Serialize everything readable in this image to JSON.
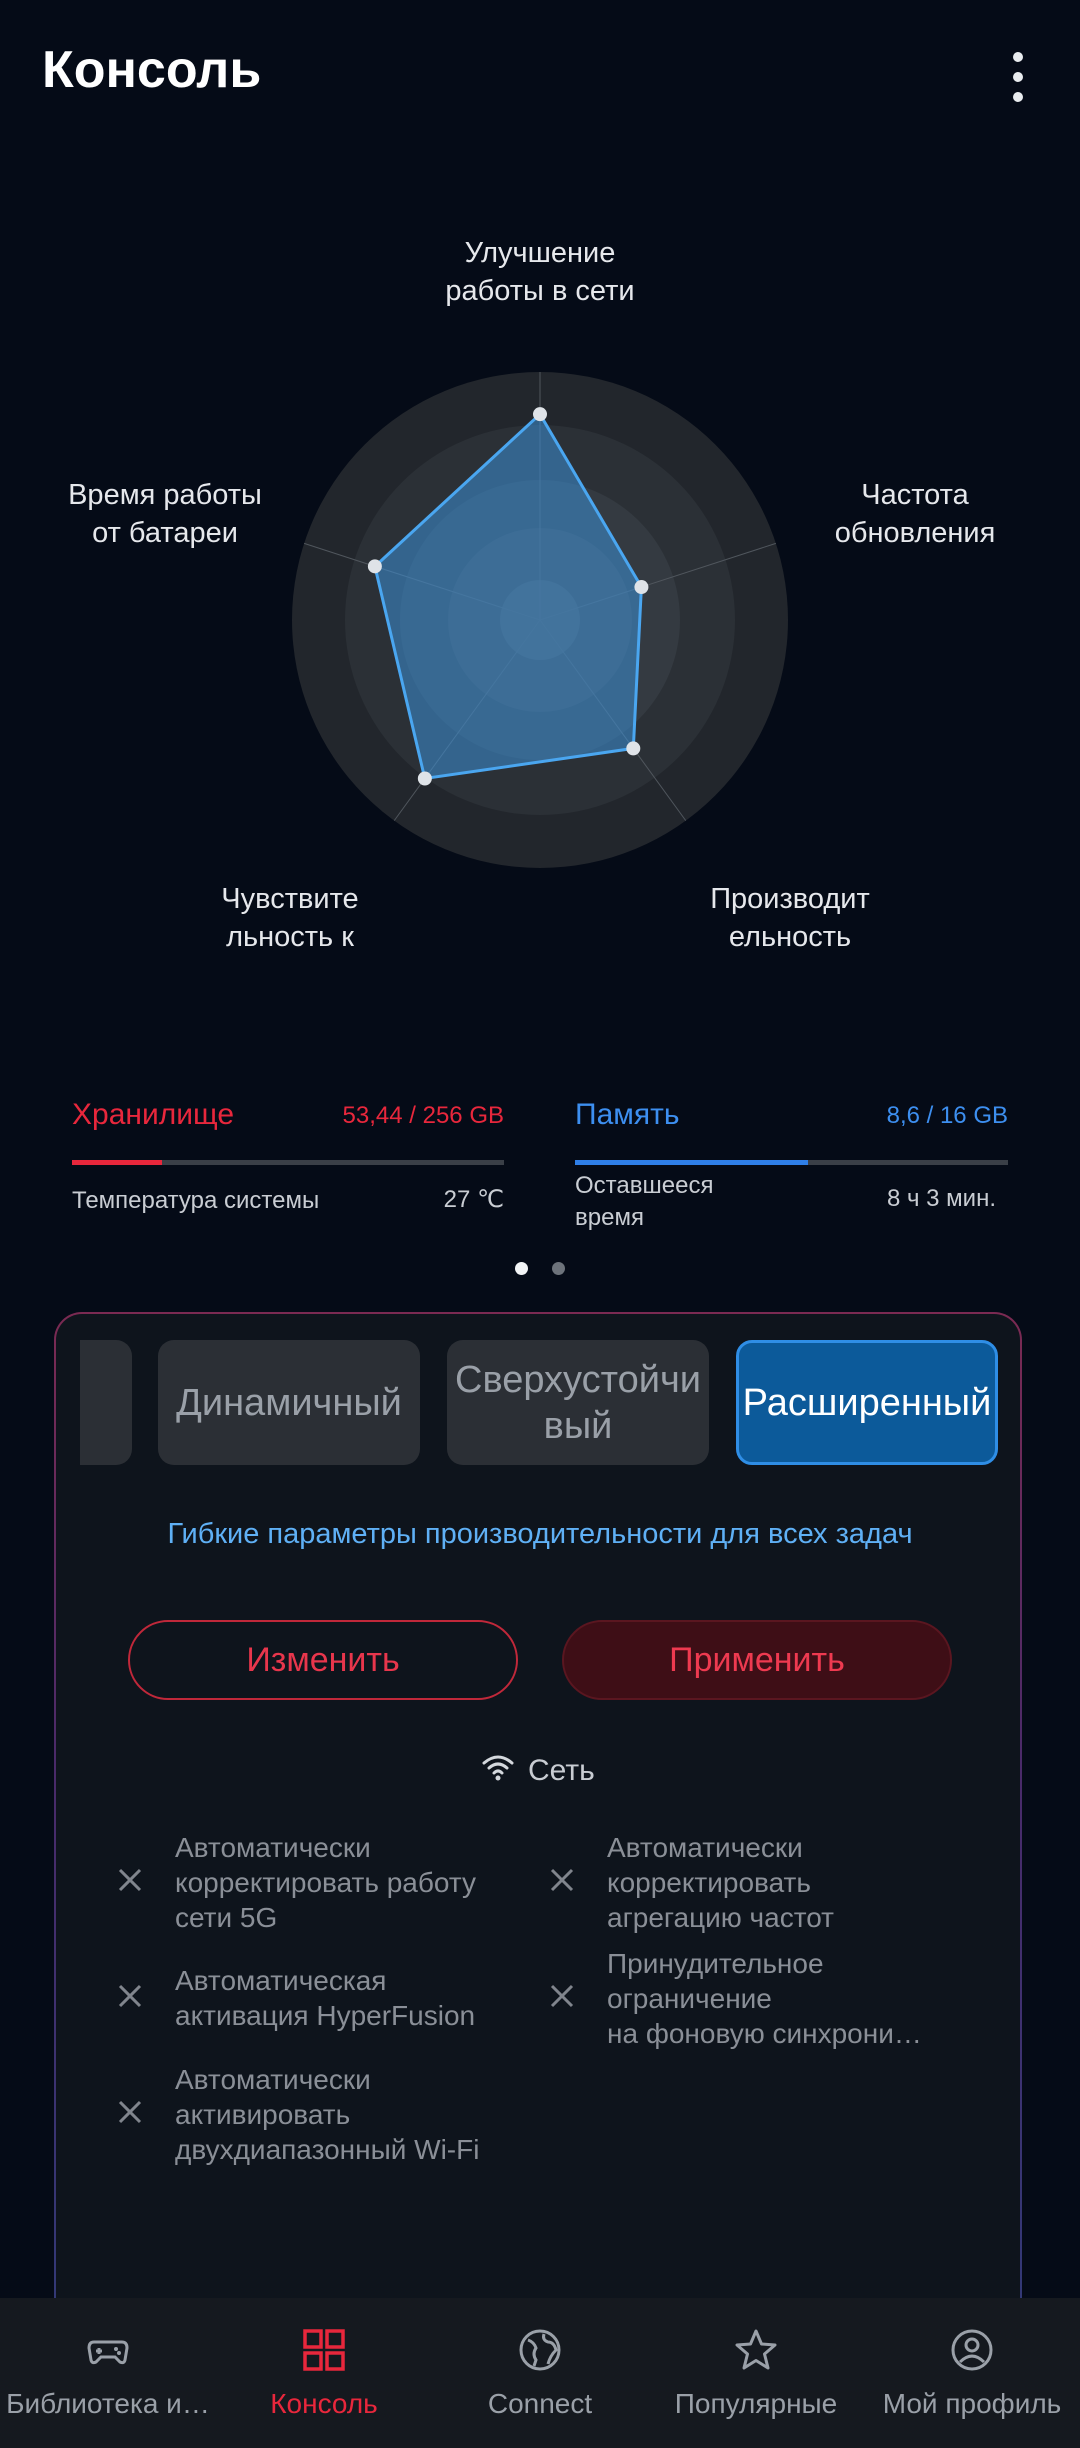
{
  "header": {
    "title": "Консоль",
    "more_icon": "more-vert-icon"
  },
  "radar": {
    "axes": [
      {
        "label": "Улучшение работы в сети",
        "line1": "Улучшение",
        "line2": "работы в сети",
        "value": 0.83
      },
      {
        "label": "Частота обновления",
        "line1": "Частота",
        "line2": "обновления",
        "value": 0.43
      },
      {
        "label": "Производительность",
        "line1": "Производит",
        "line2": "ельность",
        "value": 0.64
      },
      {
        "label": "Чувствительность к",
        "line1": "Чувствите",
        "line2": "льность к",
        "value": 0.79
      },
      {
        "label": "Время работы от батареи",
        "line1": "Время работы",
        "line2": "от батареи",
        "value": 0.7
      }
    ],
    "fill_color": "#3d8fd6",
    "stroke_color": "#4aa6f0"
  },
  "stats": {
    "storage": {
      "title": "Хранилище",
      "value": "53,44 / 256 GB",
      "fraction": 0.2088,
      "color": "#e8273c"
    },
    "memory": {
      "title": "Память",
      "value": "8,6 / 16 GB",
      "fraction": 0.5375,
      "color": "#2f7fe8"
    },
    "temp": {
      "label": "Температура системы",
      "value": "27 ℃"
    },
    "remaining": {
      "label_line1": "Оставшееся",
      "label_line2": "время",
      "value": "8 ч 3 мин."
    }
  },
  "pager": {
    "pages": 2,
    "current": 1
  },
  "modes": {
    "items": [
      {
        "label": ""
      },
      {
        "label": "Динамичный"
      },
      {
        "label_line1": "Сверхустойчи",
        "label_line2": "вый"
      },
      {
        "label": "Расширенный",
        "active": true
      }
    ],
    "description": "Гибкие параметры производительности для всех задач",
    "edit_button": "Изменить",
    "apply_button": "Применить"
  },
  "network": {
    "title": "Сеть",
    "options": [
      {
        "l1": "Автоматически",
        "l2": "корректировать работу",
        "l3": "сети 5G"
      },
      {
        "l1": "Автоматически",
        "l2": "корректировать",
        "l3": "агрегацию частот"
      },
      {
        "l1": "Автоматическая",
        "l2": "активация HyperFusion",
        "l3": ""
      },
      {
        "l1": "Принудительное",
        "l2": "ограничение",
        "l3": "на фоновую синхрони…"
      },
      {
        "l1": "Автоматически",
        "l2": "активировать",
        "l3": "двухдиапазонный Wi-Fi"
      }
    ]
  },
  "nav": {
    "items": [
      {
        "label": "Библиотека и…",
        "icon": "gamepad-icon"
      },
      {
        "label": "Консоль",
        "icon": "dashboard-icon",
        "active": true
      },
      {
        "label": "Connect",
        "icon": "globe-icon"
      },
      {
        "label": "Популярные",
        "icon": "star-icon"
      },
      {
        "label": "Мой профиль",
        "icon": "profile-icon"
      }
    ]
  }
}
